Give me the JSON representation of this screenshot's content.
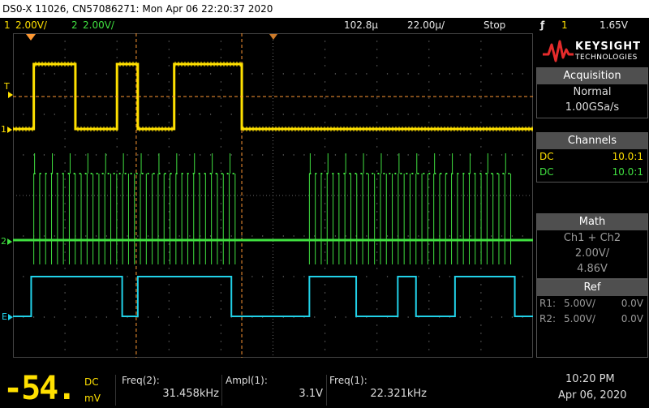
{
  "title": "DS0-X 11026, CN57086271: Mon Apr 06 22:20:37 2020",
  "status": {
    "ch1_num": "1",
    "ch1_scale": "2.00V/",
    "ch2_num": "2",
    "ch2_scale": "2.00V/",
    "delay": "102.8µ",
    "timebase": "22.00µ/",
    "run_state": "Stop",
    "trigger_symbol": "ƒ",
    "trigger_channel": "1",
    "trigger_level": "1.65V"
  },
  "markers": {
    "trigger": "T",
    "ch1": "1",
    "ch2": "2",
    "ext": "E"
  },
  "logo": {
    "line1": "KEYSIGHT",
    "line2": "TECHNOLOGIES"
  },
  "acquisition": {
    "header": "Acquisition",
    "mode": "Normal",
    "rate": "1.00GSa/s"
  },
  "channels": {
    "header": "Channels",
    "rows": [
      {
        "coupling": "DC",
        "probe": "10.0:1"
      },
      {
        "coupling": "DC",
        "probe": "10.0:1"
      }
    ]
  },
  "math": {
    "header": "Math",
    "function": "Ch1 + Ch2",
    "scale": "2.00V/",
    "offset": "4.86V"
  },
  "ref": {
    "header": "Ref",
    "rows": [
      {
        "label": "R1:",
        "scale": "5.00V/",
        "offset": "0.0V"
      },
      {
        "label": "R2:",
        "scale": "5.00V/",
        "offset": "0.0V"
      }
    ]
  },
  "meter": {
    "digits": "-54.",
    "coupling": "DC",
    "unit": "mV"
  },
  "measurements": [
    {
      "label": "Freq(2):",
      "value": "31.458kHz"
    },
    {
      "label": "Ampl(1):",
      "value": "3.1V"
    },
    {
      "label": "Freq(1):",
      "value": "22.321kHz"
    }
  ],
  "clock": {
    "time": "10:20 PM",
    "date": "Apr 06, 2020"
  },
  "colors": {
    "ch1": "#ffe000",
    "ch2": "#40e040",
    "ext": "#21d1e8",
    "cursor": "#ff9933",
    "grid": "#6a6a6a"
  },
  "chart_data": {
    "type": "line",
    "series": [
      {
        "color": "#ffe000",
        "segments": [
          {
            "level": "high",
            "x": [
              0.04,
              0.12
            ]
          },
          {
            "level": "low",
            "x": [
              0.12,
              0.2
            ]
          },
          {
            "level": "high",
            "x": [
              0.2,
              0.24
            ]
          },
          {
            "level": "low",
            "x": [
              0.24,
              0.31
            ]
          },
          {
            "level": "high",
            "x": [
              0.31,
              0.44
            ]
          },
          {
            "level": "low",
            "x": [
              0.44,
              1.0
            ]
          }
        ]
      },
      {
        "color": "#40e040",
        "bursts": [
          [
            0.04,
            0.43
          ],
          [
            0.57,
            0.96
          ]
        ],
        "idle": [
          [
            0.0,
            0.04
          ],
          [
            0.43,
            0.57
          ],
          [
            0.96,
            1.0
          ]
        ]
      },
      {
        "color": "#21d1e8",
        "segments": [
          {
            "level": "low",
            "x": [
              0.0,
              0.035
            ]
          },
          {
            "level": "high",
            "x": [
              0.035,
              0.21
            ]
          },
          {
            "level": "low",
            "x": [
              0.21,
              0.24
            ]
          },
          {
            "level": "high",
            "x": [
              0.24,
              0.42
            ]
          },
          {
            "level": "low",
            "x": [
              0.42,
              0.57
            ]
          },
          {
            "level": "high",
            "x": [
              0.57,
              0.66
            ]
          },
          {
            "level": "low",
            "x": [
              0.66,
              0.74
            ]
          },
          {
            "level": "high",
            "x": [
              0.74,
              0.775
            ]
          },
          {
            "level": "low",
            "x": [
              0.775,
              0.85
            ]
          },
          {
            "level": "high",
            "x": [
              0.85,
              0.965
            ]
          },
          {
            "level": "low",
            "x": [
              0.965,
              1.0
            ]
          }
        ]
      }
    ],
    "cursors_x": [
      0.237,
      0.44
    ]
  }
}
